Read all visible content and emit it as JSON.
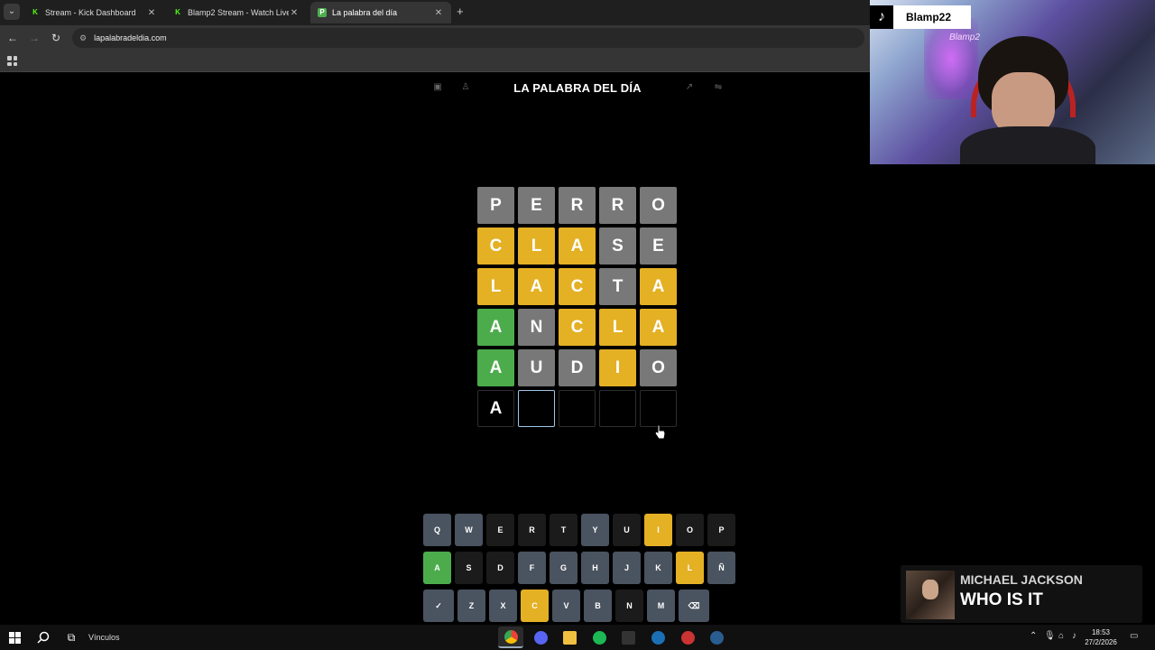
{
  "browser": {
    "tabs": [
      {
        "label": "Stream - Kick Dashboard",
        "favicon": "kick-icon",
        "active": false
      },
      {
        "label": "Blamp2 Stream - Watch Live on",
        "favicon": "kick-icon",
        "active": false
      },
      {
        "label": "La palabra del día",
        "favicon": "p-icon",
        "active": true
      }
    ],
    "url": "lapalabradeldia.com"
  },
  "game": {
    "title": "LA PALABRA DEL DÍA",
    "board": [
      [
        {
          "l": "P",
          "s": "gray"
        },
        {
          "l": "E",
          "s": "gray"
        },
        {
          "l": "R",
          "s": "gray"
        },
        {
          "l": "R",
          "s": "gray"
        },
        {
          "l": "O",
          "s": "gray"
        }
      ],
      [
        {
          "l": "C",
          "s": "yellow"
        },
        {
          "l": "L",
          "s": "yellow"
        },
        {
          "l": "A",
          "s": "yellow"
        },
        {
          "l": "S",
          "s": "gray"
        },
        {
          "l": "E",
          "s": "gray"
        }
      ],
      [
        {
          "l": "L",
          "s": "yellow"
        },
        {
          "l": "A",
          "s": "yellow"
        },
        {
          "l": "C",
          "s": "yellow"
        },
        {
          "l": "T",
          "s": "gray"
        },
        {
          "l": "A",
          "s": "yellow"
        }
      ],
      [
        {
          "l": "A",
          "s": "green"
        },
        {
          "l": "N",
          "s": "gray"
        },
        {
          "l": "C",
          "s": "yellow"
        },
        {
          "l": "L",
          "s": "yellow"
        },
        {
          "l": "A",
          "s": "yellow"
        }
      ],
      [
        {
          "l": "A",
          "s": "green"
        },
        {
          "l": "U",
          "s": "gray"
        },
        {
          "l": "D",
          "s": "gray"
        },
        {
          "l": "I",
          "s": "yellow"
        },
        {
          "l": "O",
          "s": "gray"
        }
      ],
      [
        {
          "l": "A",
          "s": "typed"
        },
        {
          "l": "",
          "s": "cursor"
        },
        {
          "l": "",
          "s": "empty"
        },
        {
          "l": "",
          "s": "empty"
        },
        {
          "l": "",
          "s": "empty"
        }
      ]
    ],
    "keyboard": [
      [
        {
          "k": "Q",
          "s": "used"
        },
        {
          "k": "W",
          "s": "used"
        },
        {
          "k": "E",
          "s": ""
        },
        {
          "k": "R",
          "s": ""
        },
        {
          "k": "T",
          "s": ""
        },
        {
          "k": "Y",
          "s": "used"
        },
        {
          "k": "U",
          "s": ""
        },
        {
          "k": "I",
          "s": "y"
        },
        {
          "k": "O",
          "s": ""
        },
        {
          "k": "P",
          "s": ""
        }
      ],
      [
        {
          "k": "A",
          "s": "g"
        },
        {
          "k": "S",
          "s": ""
        },
        {
          "k": "D",
          "s": ""
        },
        {
          "k": "F",
          "s": "used"
        },
        {
          "k": "G",
          "s": "used"
        },
        {
          "k": "H",
          "s": "used"
        },
        {
          "k": "J",
          "s": "used"
        },
        {
          "k": "K",
          "s": "used"
        },
        {
          "k": "L",
          "s": "y"
        },
        {
          "k": "Ñ",
          "s": "used"
        }
      ],
      [
        {
          "k": "✓",
          "s": "used",
          "wide": true
        },
        {
          "k": "Z",
          "s": "used"
        },
        {
          "k": "X",
          "s": "used"
        },
        {
          "k": "C",
          "s": "y"
        },
        {
          "k": "V",
          "s": "used"
        },
        {
          "k": "B",
          "s": "used"
        },
        {
          "k": "N",
          "s": ""
        },
        {
          "k": "M",
          "s": "used"
        },
        {
          "k": "⌫",
          "s": "used",
          "wide": true
        }
      ]
    ]
  },
  "overlay": {
    "tiktok_name": "Blamp22",
    "neon_sign": "Blamp2",
    "music_artist": "MICHAEL JACKSON",
    "music_title": "WHO IS IT"
  },
  "taskbar": {
    "label": "Vínculos",
    "time": "18:53",
    "date": "27/2/2026"
  },
  "colors": {
    "tile_gray": "#787878",
    "tile_yellow": "#e4b024",
    "tile_green": "#4cac4c",
    "key_used": "#4a5360"
  }
}
